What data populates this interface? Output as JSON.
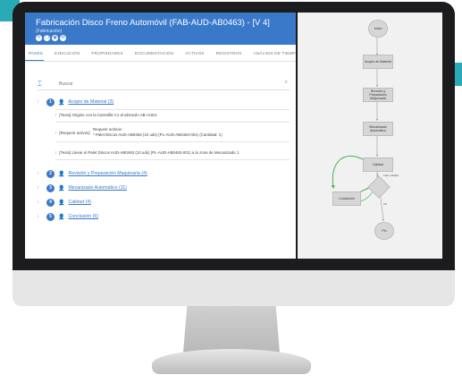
{
  "app": {
    "title": "Fabricación Disco Freno Automóvil (FAB-AUD-AB0463) - [V 4]",
    "subtitle": "(Fabricación)",
    "header_icons": [
      "edit-icon",
      "copy-icon",
      "view-icon",
      "comment-icon"
    ]
  },
  "tabs": [
    "PASES",
    "EJECUCIÓN",
    "PROPIEDADES",
    "DOCUMENTACIÓN",
    "ACTIVOS",
    "REGISTROS",
    "ANÁLISIS DE TIEMPOS"
  ],
  "search": {
    "placeholder": "Buscar"
  },
  "steps": [
    {
      "num": "1",
      "label": "Acopio de Material (3)"
    },
    {
      "num": "2",
      "label": "Revisión y Preparación Maquinaria (4)"
    },
    {
      "num": "3",
      "label": "Mecanizado Automático (11)"
    },
    {
      "num": "4",
      "label": "Calidad (4)"
    },
    {
      "num": "5",
      "label": "Conclusión (6)"
    }
  ],
  "substeps": {
    "a": "[Texto] Origine con la Carretilla C1 al almacén AB-AUD1",
    "b_label": "[Requerir activos]",
    "b_title": "Requerir activos:",
    "b_text": "* Palet Discos AUD-AB0463 (10 uds) (PL-AUD-AB0463-001) (Cantidad: 1)",
    "c": "[Texto] Llevar el Palet Discos AUD-AB0463 (10 uds) (PL-AUD-AB0463-001) a la zona de Mecanizado 1"
  },
  "flow": {
    "start": "Inicio",
    "n1": "Acopio de Material",
    "n2": "Revisión y Preparación Maquinaria",
    "n3": "Mecanizado Automático",
    "n4": "Calidad",
    "n5": "Conclusión",
    "end": "Fin",
    "edge_a": "Fallo calidad",
    "edge_b": "OK"
  },
  "colors": {
    "accent": "#3a79c9",
    "brand_bg": "#2aa9b7",
    "flow_edge": "#4caf50"
  }
}
